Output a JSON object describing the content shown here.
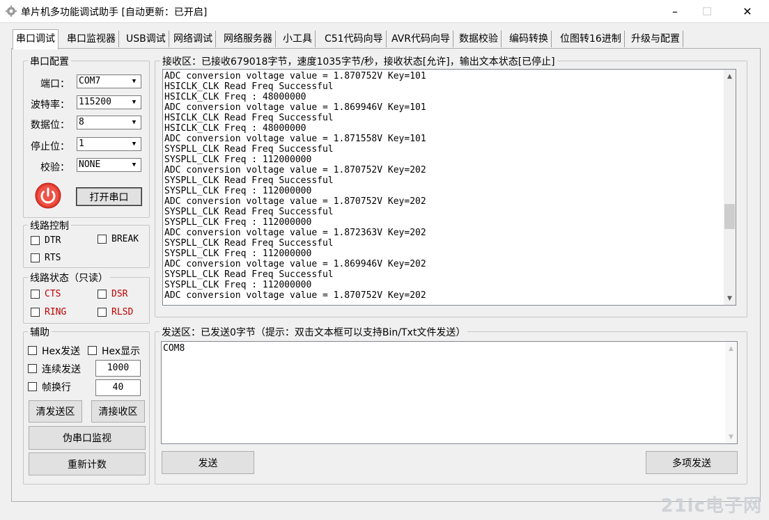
{
  "window": {
    "title": "单片机多功能调试助手 [自动更新：已开启]",
    "minimize": "–",
    "maximize": "☐",
    "close": "✕"
  },
  "tabs": [
    "串口调试",
    "串口监视器",
    "USB调试",
    "网络调试",
    "网络服务器",
    "小工具",
    "C51代码向导",
    "AVR代码向导",
    "数据校验",
    "编码转换",
    "位图转16进制",
    "升级与配置"
  ],
  "serial_config": {
    "title": "串口配置",
    "port_label": "端口：",
    "port_value": "COM7",
    "baud_label": "波特率：",
    "baud_value": "115200",
    "data_label": "数据位：",
    "data_value": "8",
    "stop_label": "停止位：",
    "stop_value": "1",
    "parity_label": "校验：",
    "parity_value": "NONE",
    "open_button": "打开串口"
  },
  "line_control": {
    "title": "线路控制",
    "dtr": "DTR",
    "break": "BREAK",
    "rts": "RTS"
  },
  "line_status": {
    "title": "线路状态（只读）",
    "cts": "CTS",
    "dsr": "DSR",
    "ring": "RING",
    "rlsd": "RLSD"
  },
  "assist": {
    "title": "辅助",
    "hex_send": "Hex发送",
    "hex_display": "Hex显示",
    "continuous_send": "连续发送",
    "continuous_value": "1000",
    "frame_wrap": "帧换行",
    "frame_value": "40",
    "clear_send": "清发送区",
    "clear_recv": "清接收区",
    "fake_monitor": "伪串口监视",
    "recount": "重新计数"
  },
  "receive": {
    "title": "接收区：已接收679018字节，速度1035字节/秒，接收状态[允许]，输出文本状态[已停止]",
    "lines": [
      "ADC conversion voltage value = 1.870752V Key=101",
      "HSICLK_CLK Read Freq Successful",
      "HSICLK_CLK Freq : 48000000",
      "ADC conversion voltage value = 1.869946V Key=101",
      "HSICLK_CLK Read Freq Successful",
      "HSICLK_CLK Freq : 48000000",
      "ADC conversion voltage value = 1.871558V Key=101",
      "SYSPLL_CLK Read Freq Successful",
      "SYSPLL_CLK Freq : 112000000",
      "ADC conversion voltage value = 1.870752V Key=202",
      "SYSPLL_CLK Read Freq Successful",
      "SYSPLL_CLK Freq : 112000000",
      "ADC conversion voltage value = 1.870752V Key=202",
      "SYSPLL_CLK Read Freq Successful",
      "SYSPLL_CLK Freq : 112000000",
      "ADC conversion voltage value = 1.872363V Key=202",
      "SYSPLL_CLK Read Freq Successful",
      "SYSPLL_CLK Freq : 112000000",
      "ADC conversion voltage value = 1.869946V Key=202",
      "SYSPLL_CLK Read Freq Successful",
      "SYSPLL_CLK Freq : 112000000",
      "ADC conversion voltage value = 1.870752V Key=202"
    ]
  },
  "send": {
    "title": "发送区：已发送0字节（提示：双击文本框可以支持Bin/Txt文件发送）",
    "text": "COM8",
    "send_button": "发送",
    "multi_send_button": "多项发送"
  },
  "watermark": "21ic电子网"
}
